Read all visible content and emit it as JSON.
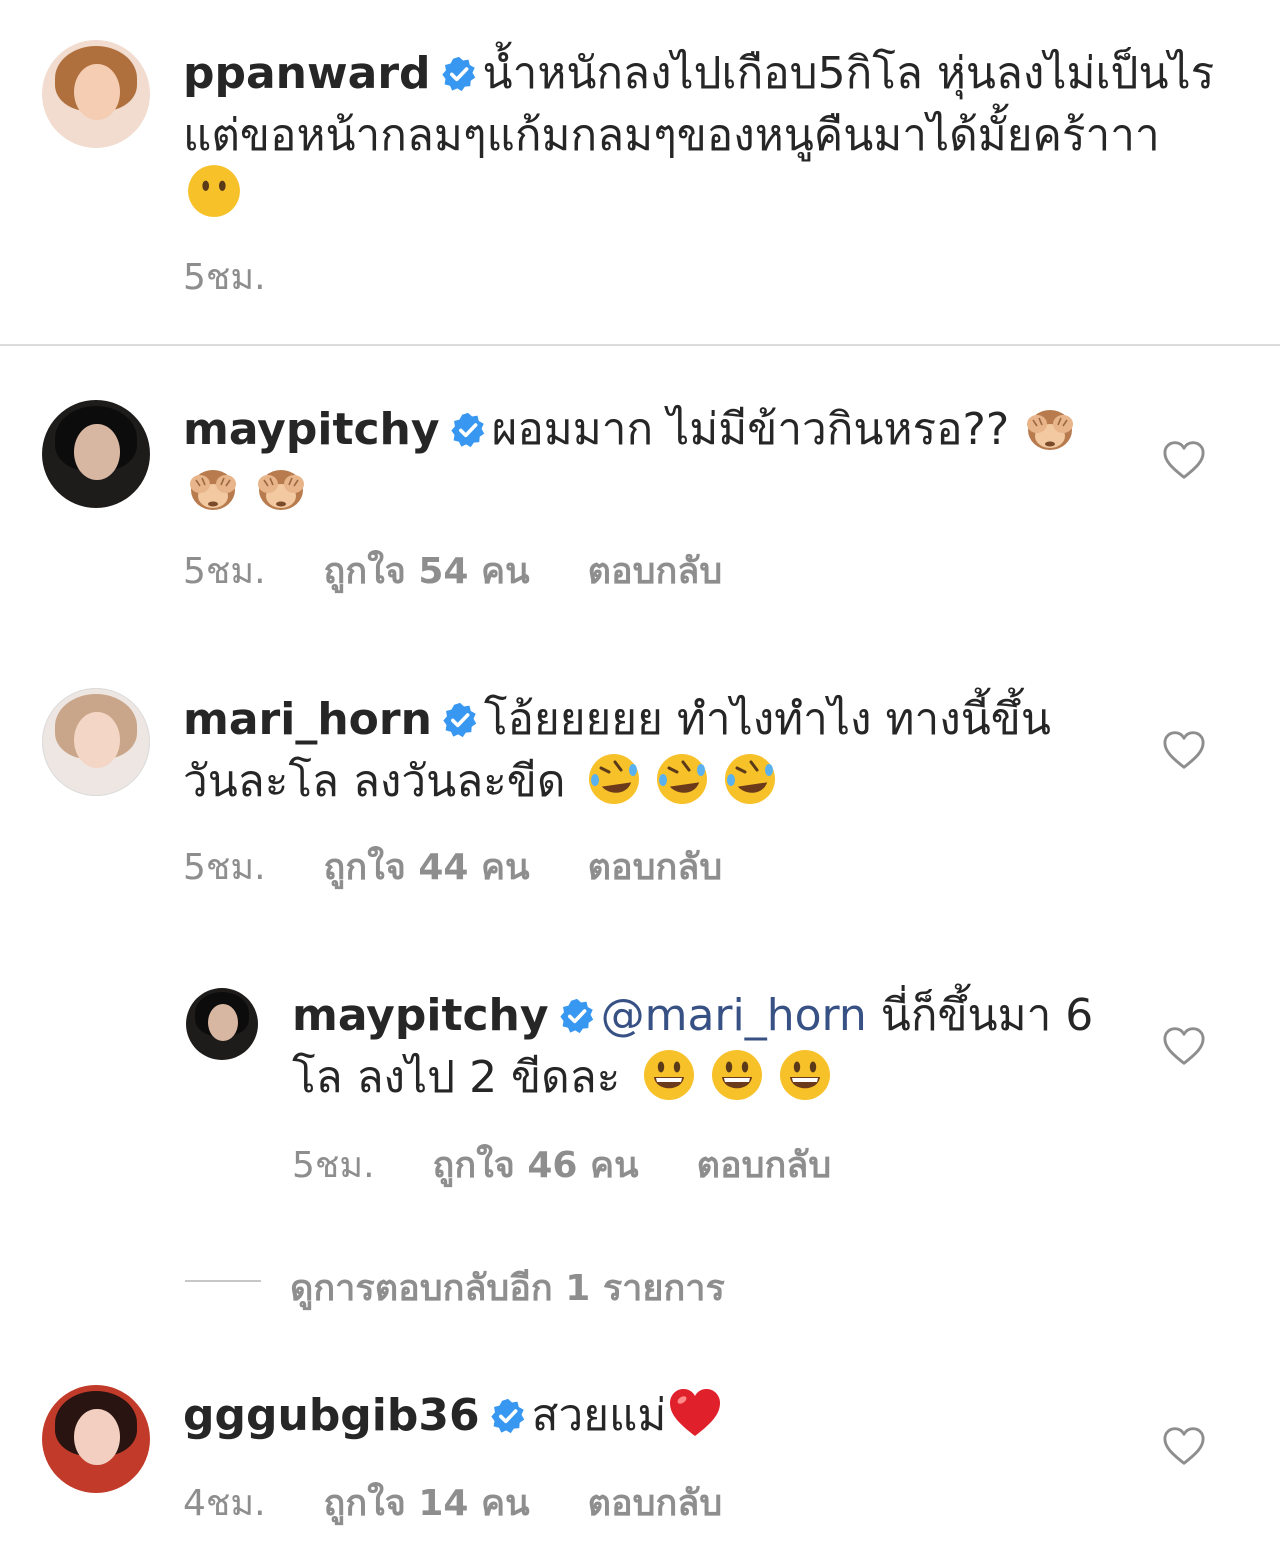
{
  "caption": {
    "username": "ppanward",
    "text_line1": "น้ำหนักลงไปเกือบ5กิโล หุ่นลงไม่เป็นไร",
    "text_line2": "แต่ขอหน้ากลมๆแก้มกลมๆของหนูคืนมาได้มั้ยคร้าาา",
    "emoji": "neutral-face",
    "time": "5ชม."
  },
  "comments": [
    {
      "username": "maypitchy",
      "text": "ผอมมาก ไม่มีข้าวกินหรอ??",
      "emoji": "see-no-evil-monkey",
      "time": "5ชม.",
      "likes": "ถูกใจ 54 คน",
      "reply": "ตอบกลับ"
    },
    {
      "username": "mari_horn",
      "text_line1": "โอ้ยยยยย ทำไงทำไง ทางนี้ขึ้น",
      "text_line2": "วันละโล ลงวันละขีด",
      "emoji": "rofl-face",
      "time": "5ชม.",
      "likes": "ถูกใจ 44 คน",
      "reply": "ตอบกลับ"
    },
    {
      "username": "maypitchy",
      "mention": "@mari_horn",
      "text_line1": "นี่ก็ขึ้นมา 6",
      "text_line2": "โล ลงไป 2 ขีดละ",
      "emoji": "smiley-face",
      "time": "5ชม.",
      "likes": "ถูกใจ 46 คน",
      "reply": "ตอบกลับ"
    },
    {
      "username": "gggubgib36",
      "text": "สวยแม่",
      "emoji": "red-heart",
      "time": "4ชม.",
      "likes": "ถูกใจ 14 คน",
      "reply": "ตอบกลับ"
    }
  ],
  "view_more": "ดูการตอบกลับอีก 1 รายการ",
  "colors": {
    "text": "#262626",
    "muted": "#8e8e8e",
    "verified": "#3897f0",
    "mention": "#385185",
    "divider": "#dbdbdb"
  }
}
